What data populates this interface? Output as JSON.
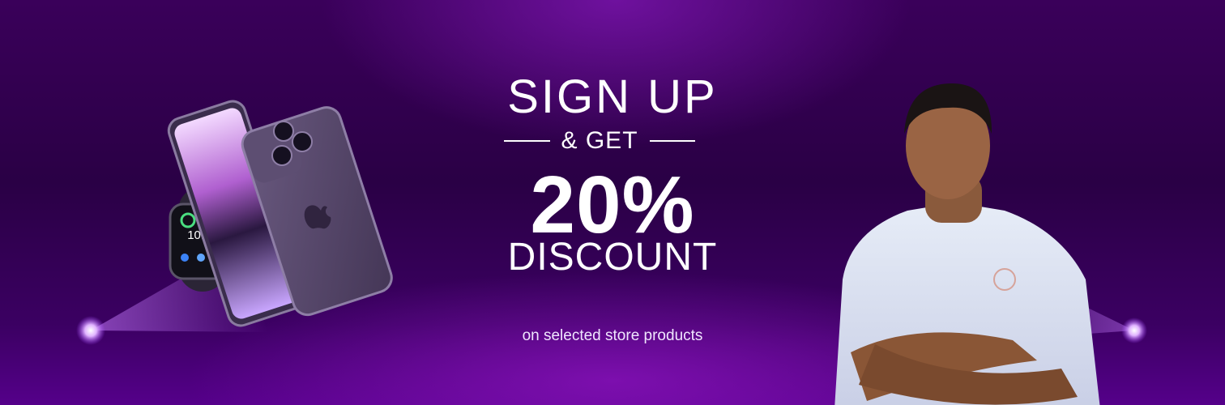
{
  "promo": {
    "line1": "SIGN UP",
    "line2": "& GET",
    "line3": "20%",
    "line4": "DISCOUNT",
    "subtext": "on selected store products"
  },
  "watch": {
    "time": "10:09"
  },
  "colors": {
    "background_dark": "#2a0045",
    "background_glow": "#7a14aa",
    "phone_purple": "#5a4a70",
    "text": "#ffffff"
  }
}
